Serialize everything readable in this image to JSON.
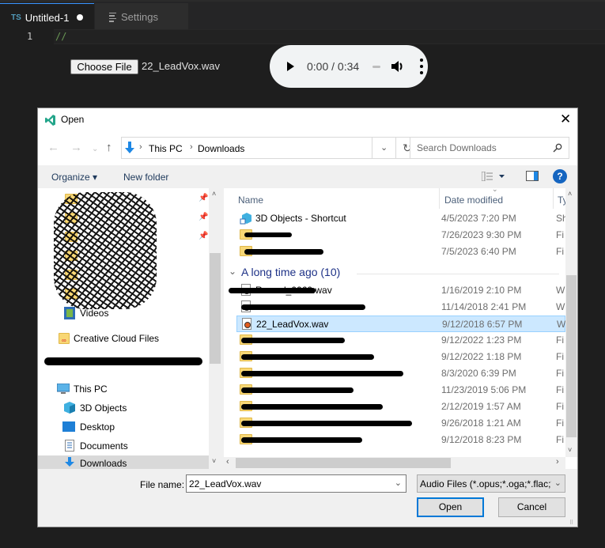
{
  "editor": {
    "tabs": [
      {
        "icon": "TS",
        "label": "Untitled-1",
        "dirty": true
      },
      {
        "label": "Settings"
      }
    ],
    "lines": [
      {
        "number": "1",
        "text": "//"
      }
    ]
  },
  "webview": {
    "choose_file_label": "Choose File",
    "chosen_file": "22_LeadVox.wav",
    "audio": {
      "time": "0:00 / 0:34"
    }
  },
  "dialog": {
    "title": "Open",
    "close": "✕",
    "nav": {
      "back": "←",
      "forward": "→",
      "recent": "⌄",
      "up": "↑"
    },
    "breadcrumb": [
      "This PC",
      "Downloads"
    ],
    "search_placeholder": "Search Downloads",
    "toolbar": {
      "organize": "Organize ▾",
      "new_folder": "New folder",
      "help": "?"
    },
    "nav_pane": {
      "quick_access_visible": "Videos",
      "creative_cloud": "Creative Cloud Files",
      "this_pc": "This PC",
      "items": [
        "3D Objects",
        "Desktop",
        "Documents",
        "Downloads"
      ],
      "selected": "Downloads"
    },
    "columns": {
      "name": "Name",
      "date": "Date modified",
      "type": "Ty"
    },
    "top_files": [
      {
        "name": "3D Objects - Shortcut",
        "date": "4/5/2023 7:20 PM",
        "type": "Sh",
        "icon": "shortcut"
      },
      {
        "name": "[redacted]",
        "date": "7/26/2023 9:30 PM",
        "type": "Fi",
        "icon": "folder"
      },
      {
        "name": "[redacted]",
        "date": "7/5/2023 6:40 PM",
        "type": "Fi",
        "icon": "folder"
      }
    ],
    "group_label": "A long time ago (10)",
    "group_files": [
      {
        "name": "Record_0060.wav",
        "date": "1/16/2019 2:10 PM",
        "type": "W",
        "icon": "wav"
      },
      {
        "name": "[redacted]",
        "date": "11/14/2018 2:41 PM",
        "type": "W",
        "icon": "wav"
      },
      {
        "name": "22_LeadVox.wav",
        "date": "9/12/2018 6:57 PM",
        "type": "W",
        "icon": "wav",
        "selected": true
      },
      {
        "name": "[redacted]",
        "date": "9/12/2022 1:23 PM",
        "type": "Fi",
        "icon": "folder"
      },
      {
        "name": "[redacted]",
        "date": "9/12/2022 1:18 PM",
        "type": "Fi",
        "icon": "folder"
      },
      {
        "name": "[redacted]",
        "date": "8/3/2020 6:39 PM",
        "type": "Fi",
        "icon": "folder"
      },
      {
        "name": "[redacted]",
        "date": "11/23/2019 5:06 PM",
        "type": "Fi",
        "icon": "folder"
      },
      {
        "name": "[redacted]",
        "date": "2/12/2019 1:57 AM",
        "type": "Fi",
        "icon": "folder"
      },
      {
        "name": "[redacted]",
        "date": "9/26/2018 1:21 AM",
        "type": "Fi",
        "icon": "folder"
      },
      {
        "name": "[redacted]",
        "date": "9/12/2018 8:23 PM",
        "type": "Fi",
        "icon": "folder"
      }
    ],
    "file_name_label": "File name:",
    "file_name_value": "22_LeadVox.wav",
    "filter_value": "Audio Files (*.opus;*.oga;*.flac;*",
    "open_label": "Open",
    "cancel_label": "Cancel"
  }
}
